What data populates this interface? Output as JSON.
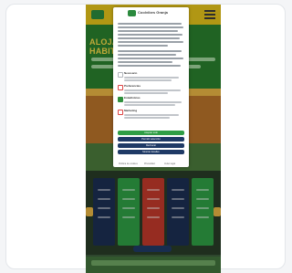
{
  "site": {
    "hero_title": "ALOJAMIENTO Y HABITACIONES"
  },
  "cookie_dialog": {
    "brand": "Coolvibes Granja",
    "options": [
      {
        "label": "Necesario",
        "checked": false
      },
      {
        "label": "Preferencias",
        "checked": false
      },
      {
        "label": "Estadísticas",
        "checked": true
      },
      {
        "label": "Marketing",
        "checked": false
      }
    ],
    "buttons": {
      "accept_all": "Aceptar todo",
      "accept_selection": "Permitir selección",
      "reject": "Rechazar",
      "customize": "Mostrar detalles"
    },
    "links": [
      "Política de cookies",
      "Privacidad",
      "Aviso legal"
    ]
  },
  "colors": {
    "accent_green": "#2f9e45",
    "navy": "#1f3a66",
    "topbar_yellow": "#e3c21a"
  }
}
